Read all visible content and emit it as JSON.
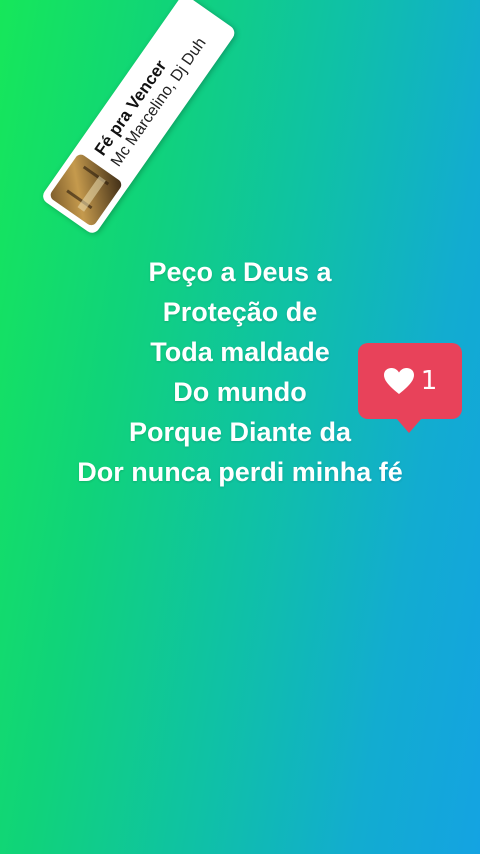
{
  "music_sticker": {
    "title": "Fé pra Vencer",
    "artist": "Mc Marcelino, Dj Duh",
    "icon": "album-art-icon"
  },
  "lyrics": {
    "lines": [
      "Peço a Deus a",
      "Proteção de",
      "Toda maldade",
      "Do mundo",
      "Porque Diante da",
      "Dor nunca perdi minha fé"
    ]
  },
  "like_sticker": {
    "icon": "heart-icon",
    "count": "1",
    "color": "#e8425a"
  },
  "background": {
    "gradient_start": "#16e75a",
    "gradient_end": "#14a3e2"
  }
}
